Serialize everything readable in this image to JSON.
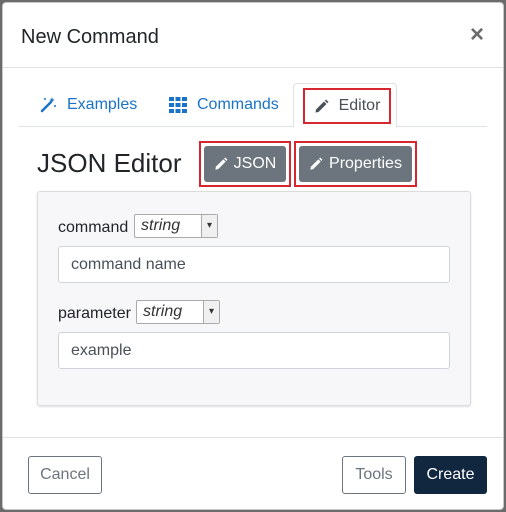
{
  "dialog": {
    "title": "New Command",
    "close_symbol": "×"
  },
  "tabs": [
    {
      "label": "Examples",
      "icon": "magic-wand-icon",
      "active": false
    },
    {
      "label": "Commands",
      "icon": "grid-icon",
      "active": false
    },
    {
      "label": "Editor",
      "icon": "pencil-icon",
      "active": true
    }
  ],
  "editor": {
    "title": "JSON Editor",
    "json_button": "JSON",
    "properties_button": "Properties"
  },
  "fields": [
    {
      "label": "command",
      "type": "string",
      "value": "command name"
    },
    {
      "label": "parameter",
      "type": "string",
      "value": "example"
    }
  ],
  "footer": {
    "cancel": "Cancel",
    "tools": "Tools",
    "create": "Create"
  },
  "colors": {
    "link": "#1a73c8",
    "highlight": "#d6262f",
    "secondary": "#6c757d",
    "primary_dark": "#10273f"
  }
}
